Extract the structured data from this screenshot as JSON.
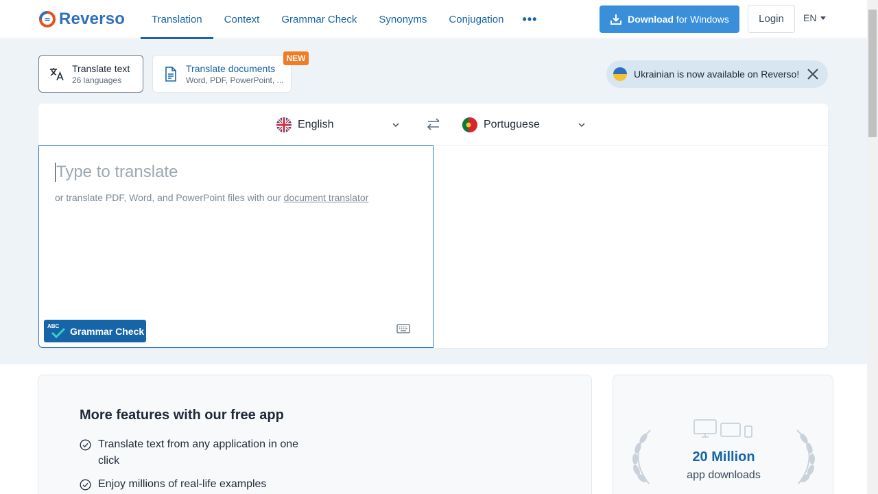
{
  "brand": {
    "name": "Reverso",
    "color": "#2f6fbf",
    "accent": "#1565a8"
  },
  "nav": {
    "items": [
      {
        "label": "Translation",
        "active": true
      },
      {
        "label": "Context"
      },
      {
        "label": "Grammar Check"
      },
      {
        "label": "Synonyms"
      },
      {
        "label": "Conjugation"
      }
    ],
    "more_label": "•••"
  },
  "header": {
    "download_label_bold": "Download",
    "download_label_rest": "for Windows",
    "login_label": "Login",
    "ui_language": "EN"
  },
  "modes": {
    "text": {
      "title": "Translate text",
      "subtitle": "26 languages"
    },
    "docs": {
      "title": "Translate documents",
      "subtitle": "Word, PDF, PowerPoint, ...",
      "badge": "NEW"
    }
  },
  "notice": {
    "text": "Ukrainian is now available on Reverso!"
  },
  "translator": {
    "source_language": "English",
    "target_language": "Portuguese",
    "placeholder": "Type to translate",
    "hint_prefix": "or translate PDF, Word, and PowerPoint files with our",
    "hint_link": "document translator",
    "grammar_button": "Grammar Check",
    "grammar_icon_text": "ABC"
  },
  "app_promo": {
    "title": "More features with our free app",
    "features": [
      "Translate text from any application in one click",
      "Enjoy millions of real-life examples"
    ]
  },
  "stats": {
    "number": "20 Million",
    "label": "app downloads"
  }
}
